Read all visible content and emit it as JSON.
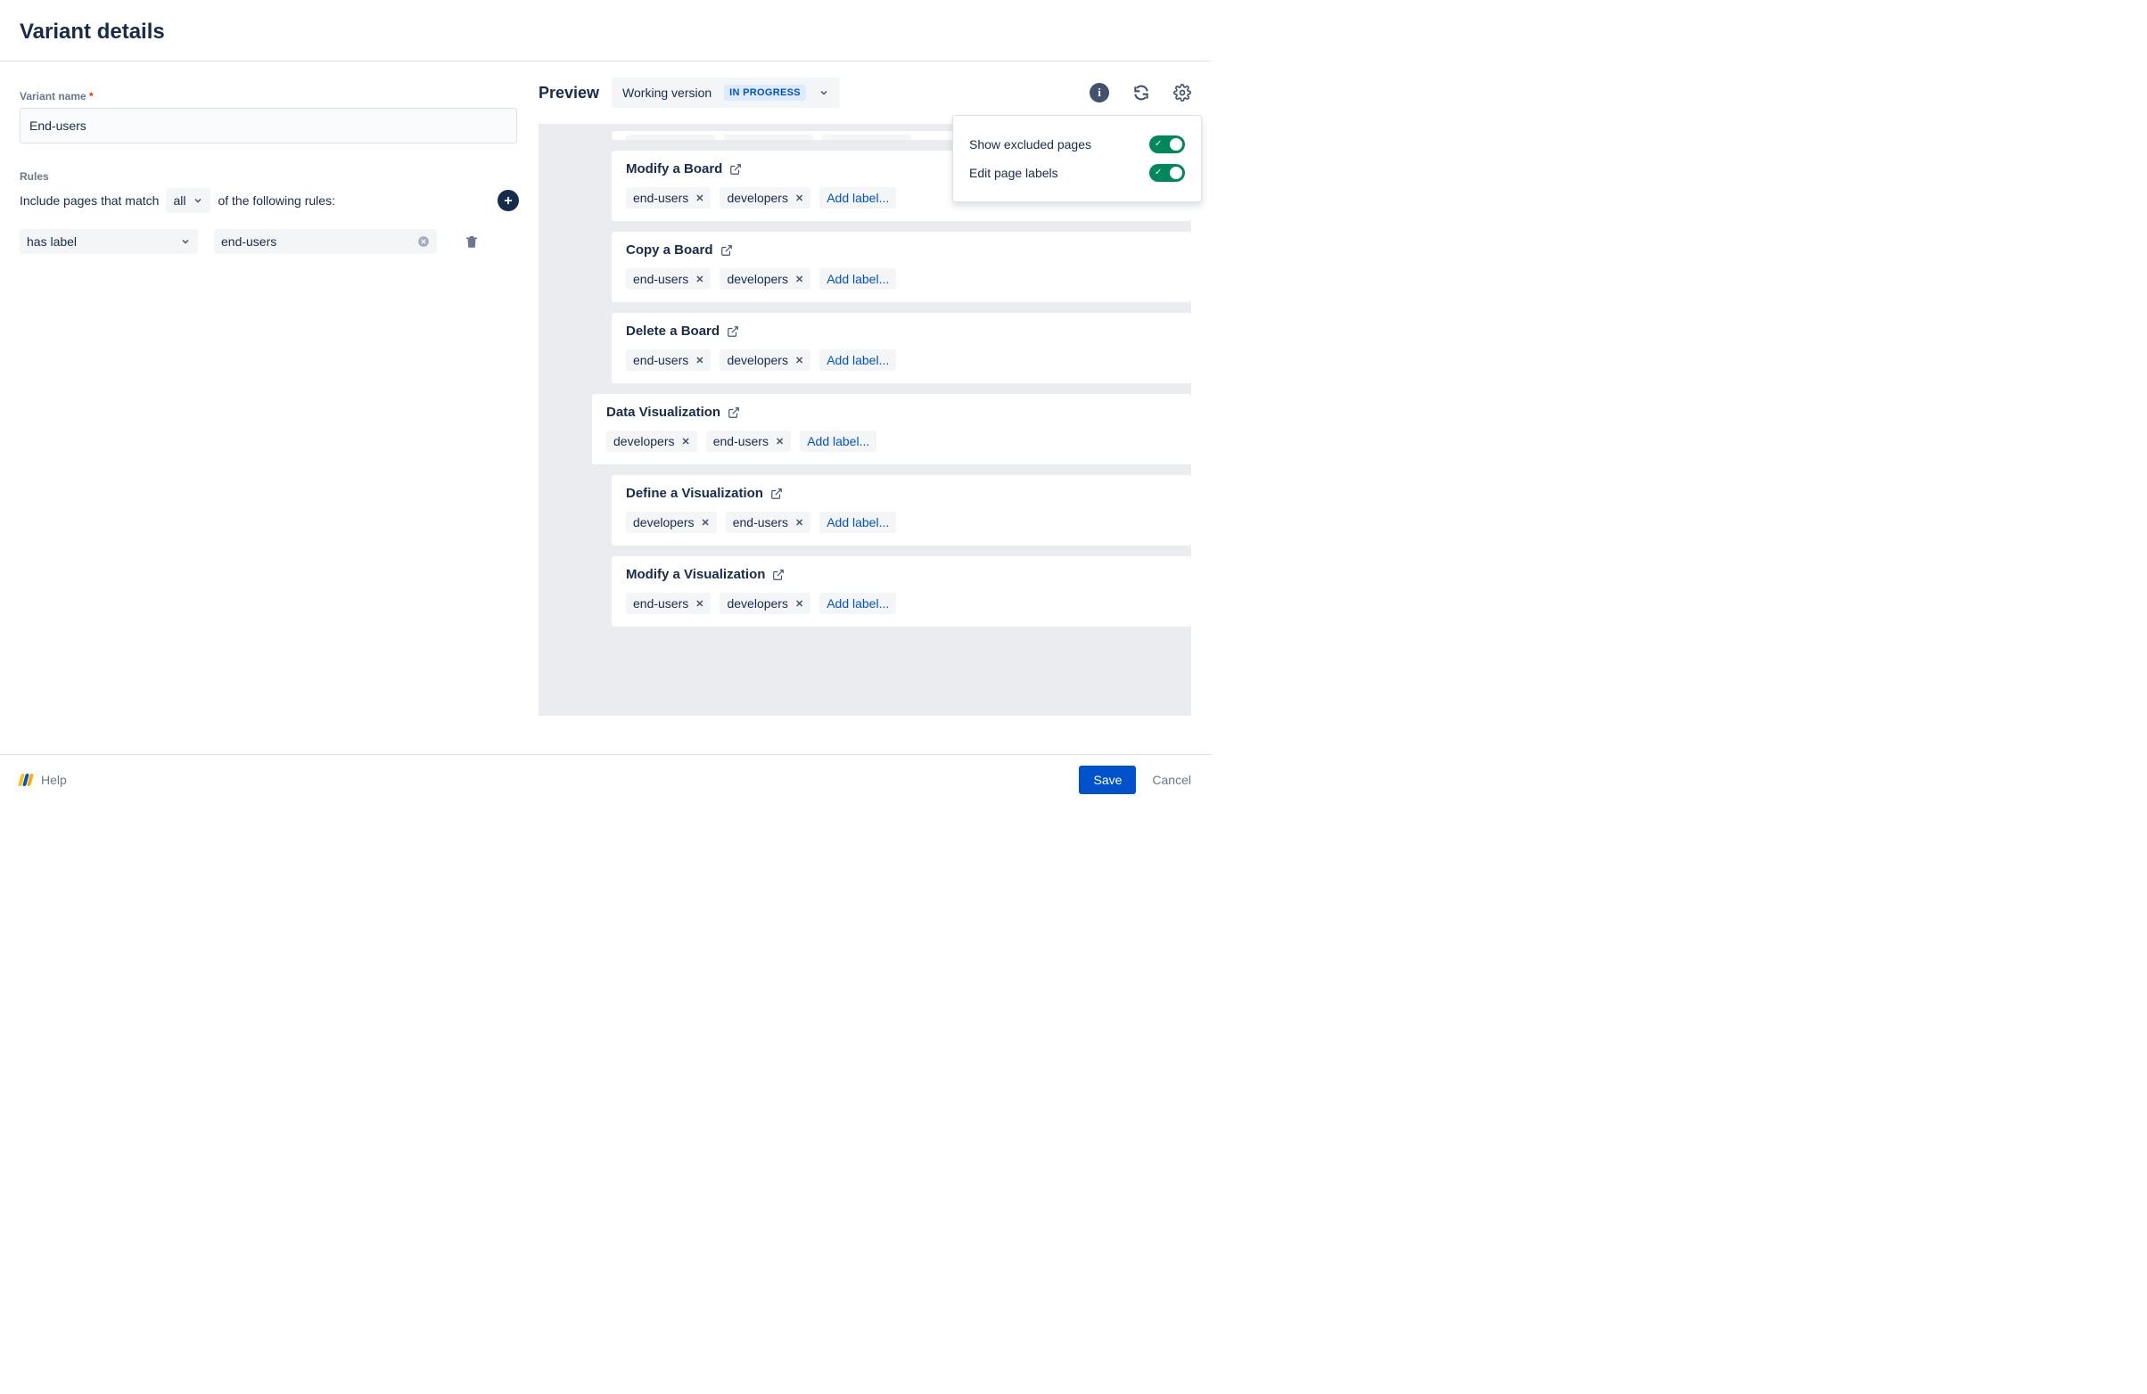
{
  "header": {
    "title": "Variant details"
  },
  "form": {
    "variant_name_label": "Variant name",
    "variant_name_value": "End-users",
    "rules_label": "Rules",
    "match_prefix": "Include pages that match",
    "match_mode": "all",
    "match_suffix": "of the following rules:",
    "rule_condition": "has label",
    "rule_value": "end-users"
  },
  "preview": {
    "title": "Preview",
    "version": "Working version",
    "status": "IN PROGRESS",
    "add_label": "Add label...",
    "cards": [
      {
        "title": "Modify a Board",
        "indent": true,
        "labels": [
          "end-users",
          "developers"
        ]
      },
      {
        "title": "Copy a Board",
        "indent": true,
        "labels": [
          "end-users",
          "developers"
        ]
      },
      {
        "title": "Delete a Board",
        "indent": true,
        "labels": [
          "end-users",
          "developers"
        ]
      },
      {
        "title": "Data Visualization",
        "indent": false,
        "labels": [
          "developers",
          "end-users"
        ]
      },
      {
        "title": "Define a Visualization",
        "indent": true,
        "labels": [
          "developers",
          "end-users"
        ]
      },
      {
        "title": "Modify a Visualization",
        "indent": true,
        "labels": [
          "end-users",
          "developers"
        ]
      }
    ]
  },
  "popover": {
    "show_excluded": "Show excluded pages",
    "edit_labels": "Edit page labels"
  },
  "footer": {
    "help": "Help",
    "save": "Save",
    "cancel": "Cancel"
  }
}
